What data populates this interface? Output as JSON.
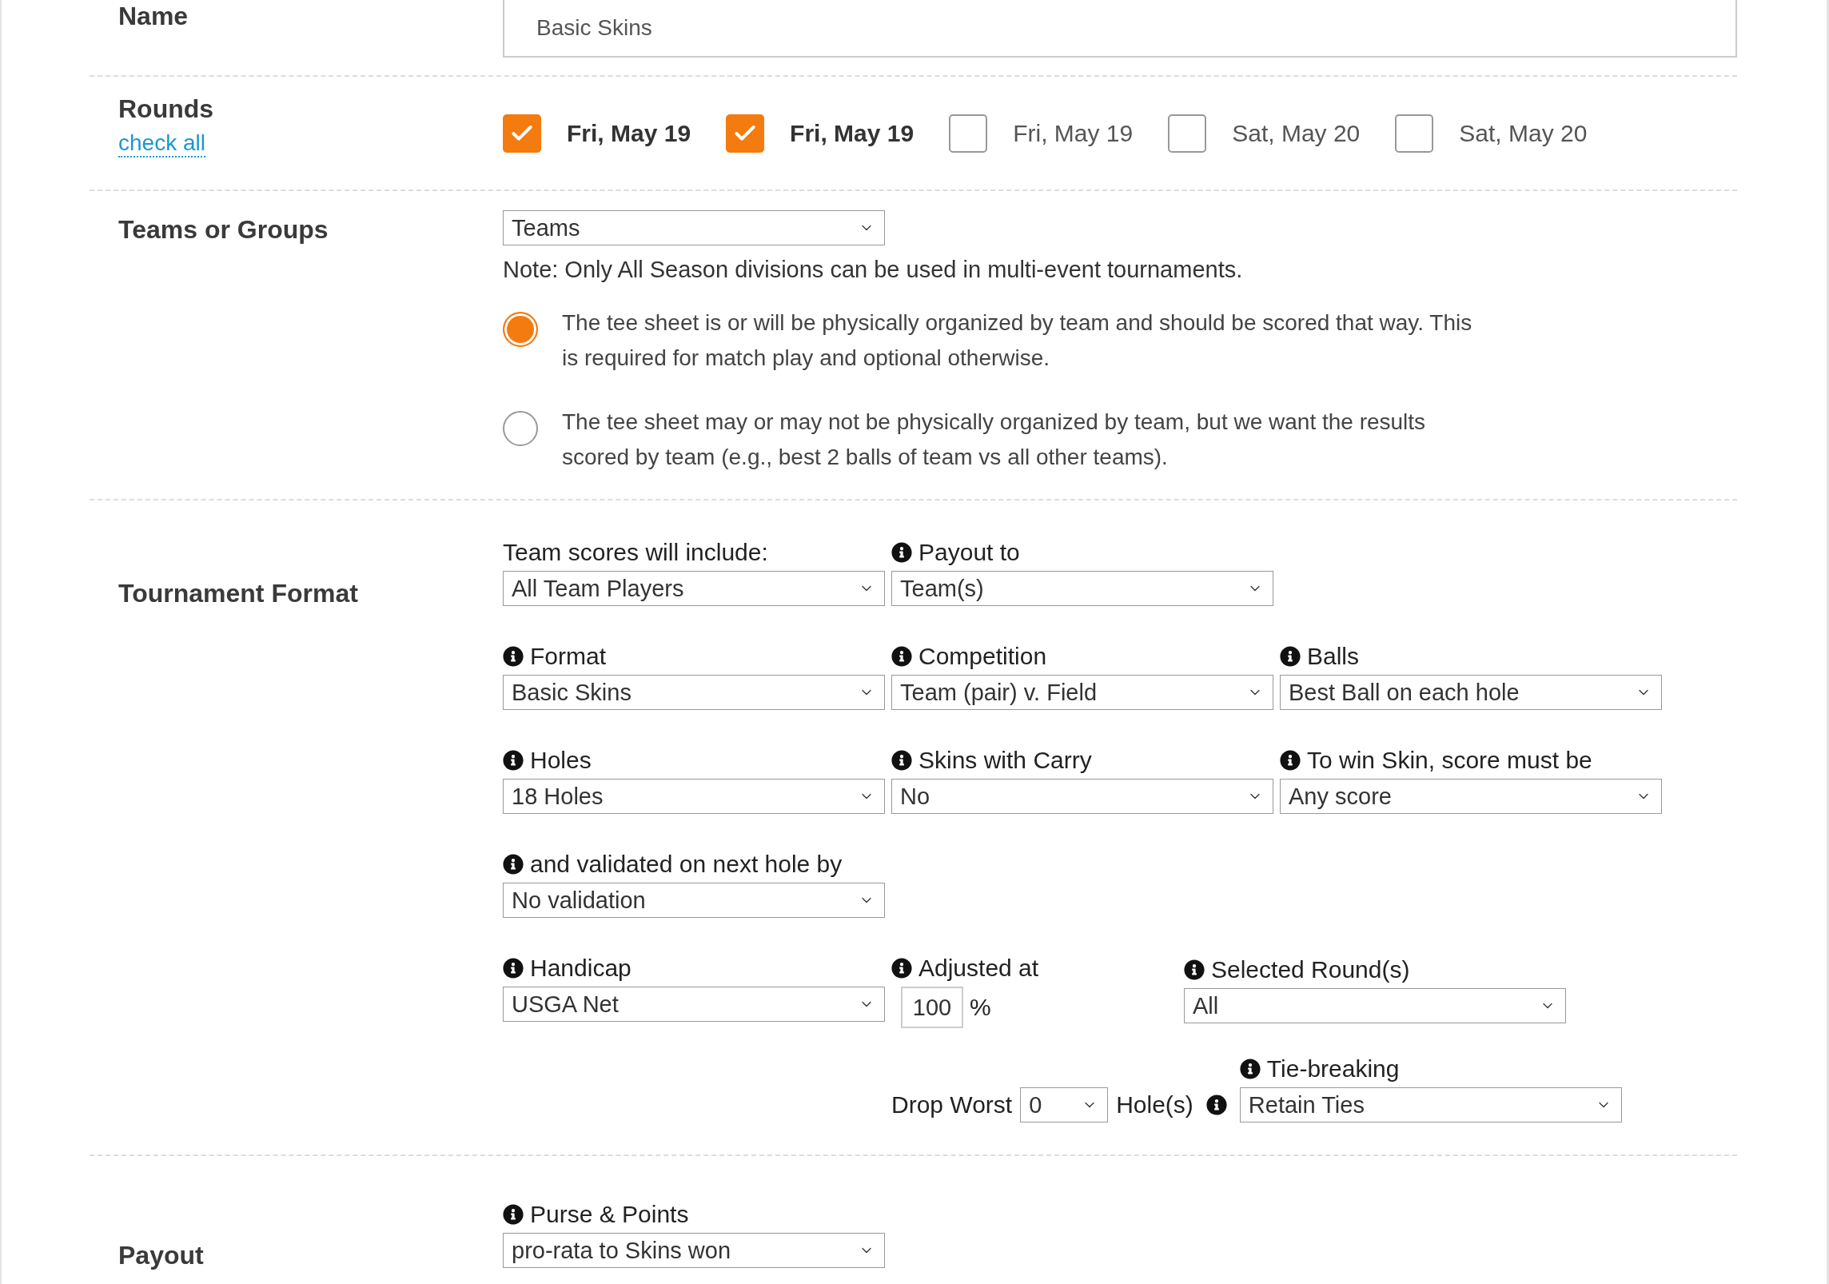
{
  "name": {
    "label": "Name",
    "value": "Basic Skins"
  },
  "rounds": {
    "label": "Rounds",
    "check_all": "check all",
    "items": [
      {
        "label": "Fri, May 19",
        "checked": true
      },
      {
        "label": "Fri, May 19",
        "checked": true
      },
      {
        "label": "Fri, May 19",
        "checked": false
      },
      {
        "label": "Sat, May 20",
        "checked": false
      },
      {
        "label": "Sat, May 20",
        "checked": false
      }
    ]
  },
  "teams": {
    "label": "Teams or Groups",
    "select": "Teams",
    "note": "Note: Only All Season divisions can be used in multi-event tournaments.",
    "options": [
      {
        "text": "The tee sheet is or will be physically organized by team and should be scored that way. This is required for match play and optional otherwise.",
        "selected": true
      },
      {
        "text": "The tee sheet may or may not be physically organized by team, but we want the results scored by team (e.g., best 2 balls of team vs all other teams).",
        "selected": false
      }
    ]
  },
  "format": {
    "label": "Tournament Format",
    "rows": [
      [
        {
          "label": "Team scores will include:",
          "info": false,
          "value": "All Team Players"
        },
        {
          "label": "Payout to",
          "info": true,
          "value": "Team(s)"
        }
      ],
      [
        {
          "label": "Format",
          "info": true,
          "value": "Basic Skins"
        },
        {
          "label": "Competition",
          "info": true,
          "value": "Team (pair) v. Field"
        },
        {
          "label": "Balls",
          "info": true,
          "value": "Best Ball on each hole"
        }
      ],
      [
        {
          "label": "Holes",
          "info": true,
          "value": "18 Holes"
        },
        {
          "label": "Skins with Carry",
          "info": true,
          "value": "No"
        },
        {
          "label": "To win Skin, score must be",
          "info": true,
          "value": "Any score"
        }
      ],
      [
        {
          "label": "and validated on next hole by",
          "info": true,
          "value": "No validation"
        }
      ]
    ],
    "handicap": {
      "label": "Handicap",
      "value": "USGA Net"
    },
    "adjusted_at": {
      "label": "Adjusted at",
      "value": "100",
      "unit": "%"
    },
    "selected_rounds": {
      "label": "Selected Round(s)",
      "value": "All"
    },
    "drop_worst": {
      "label": "Drop Worst",
      "value": "0",
      "unit": "Hole(s)"
    },
    "tie_breaking": {
      "label": "Tie-breaking",
      "value": "Retain Ties"
    }
  },
  "payout": {
    "label": "Payout",
    "field": {
      "label": "Purse & Points",
      "value": "pro-rata to Skins won"
    }
  }
}
